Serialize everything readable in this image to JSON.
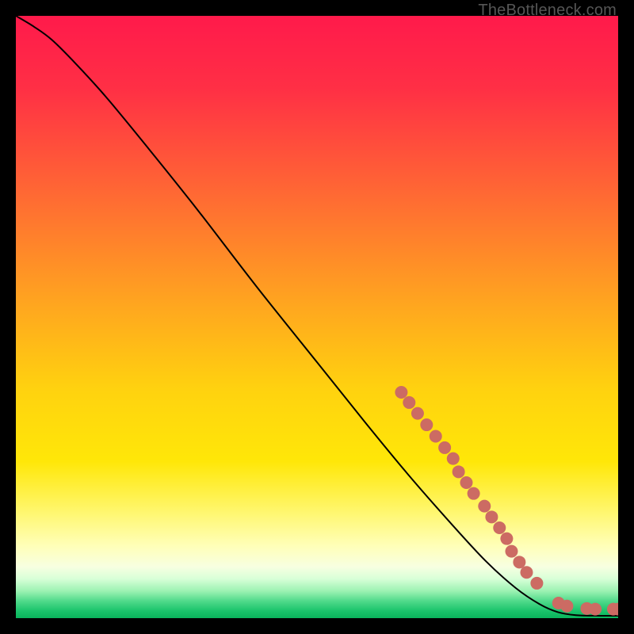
{
  "watermark": "TheBottleneck.com",
  "chart_data": {
    "type": "line",
    "xlabel": "",
    "ylabel": "",
    "xlim": [
      0,
      100
    ],
    "ylim": [
      0,
      100
    ],
    "title": "",
    "gradient_stops": [
      {
        "offset": 0.0,
        "color": "#ff1a4b"
      },
      {
        "offset": 0.12,
        "color": "#ff2f45"
      },
      {
        "offset": 0.3,
        "color": "#ff6a33"
      },
      {
        "offset": 0.48,
        "color": "#ffa61f"
      },
      {
        "offset": 0.62,
        "color": "#ffd20f"
      },
      {
        "offset": 0.74,
        "color": "#ffe708"
      },
      {
        "offset": 0.82,
        "color": "#fff66a"
      },
      {
        "offset": 0.88,
        "color": "#ffffb8"
      },
      {
        "offset": 0.915,
        "color": "#f7ffe1"
      },
      {
        "offset": 0.935,
        "color": "#d7ffd7"
      },
      {
        "offset": 0.955,
        "color": "#9cf2b2"
      },
      {
        "offset": 0.972,
        "color": "#4fd98a"
      },
      {
        "offset": 0.988,
        "color": "#1ac46b"
      },
      {
        "offset": 1.0,
        "color": "#0ab45c"
      }
    ],
    "curve": [
      {
        "x": 0.0,
        "y": 100.0
      },
      {
        "x": 3.0,
        "y": 98.2
      },
      {
        "x": 6.0,
        "y": 96.0
      },
      {
        "x": 10.0,
        "y": 92.0
      },
      {
        "x": 15.0,
        "y": 86.5
      },
      {
        "x": 22.0,
        "y": 78.0
      },
      {
        "x": 30.0,
        "y": 68.0
      },
      {
        "x": 40.0,
        "y": 55.0
      },
      {
        "x": 50.0,
        "y": 42.5
      },
      {
        "x": 58.0,
        "y": 32.5
      },
      {
        "x": 65.0,
        "y": 24.0
      },
      {
        "x": 72.0,
        "y": 16.0
      },
      {
        "x": 78.0,
        "y": 9.5
      },
      {
        "x": 83.0,
        "y": 5.0
      },
      {
        "x": 87.0,
        "y": 2.3
      },
      {
        "x": 90.0,
        "y": 1.0
      },
      {
        "x": 93.0,
        "y": 0.5
      },
      {
        "x": 97.0,
        "y": 0.4
      },
      {
        "x": 100.0,
        "y": 0.4
      }
    ],
    "marker_color": "#cc6b63",
    "marker_radius_px": 8,
    "markers": [
      {
        "x": 64.0,
        "y": 37.5
      },
      {
        "x": 65.3,
        "y": 35.8
      },
      {
        "x": 66.7,
        "y": 34.0
      },
      {
        "x": 68.2,
        "y": 32.1
      },
      {
        "x": 69.7,
        "y": 30.2
      },
      {
        "x": 71.2,
        "y": 28.3
      },
      {
        "x": 72.6,
        "y": 26.5
      },
      {
        "x": 73.5,
        "y": 24.3
      },
      {
        "x": 74.8,
        "y": 22.5
      },
      {
        "x": 76.0,
        "y": 20.7
      },
      {
        "x": 77.8,
        "y": 18.6
      },
      {
        "x": 79.0,
        "y": 16.8
      },
      {
        "x": 80.3,
        "y": 15.0
      },
      {
        "x": 81.5,
        "y": 13.2
      },
      {
        "x": 82.3,
        "y": 11.1
      },
      {
        "x": 83.6,
        "y": 9.3
      },
      {
        "x": 84.8,
        "y": 7.6
      },
      {
        "x": 86.5,
        "y": 5.8
      },
      {
        "x": 90.1,
        "y": 2.5
      },
      {
        "x": 91.5,
        "y": 2.0
      },
      {
        "x": 94.8,
        "y": 1.6
      },
      {
        "x": 96.2,
        "y": 1.5
      },
      {
        "x": 99.2,
        "y": 1.5
      },
      {
        "x": 100.0,
        "y": 1.5
      }
    ]
  }
}
